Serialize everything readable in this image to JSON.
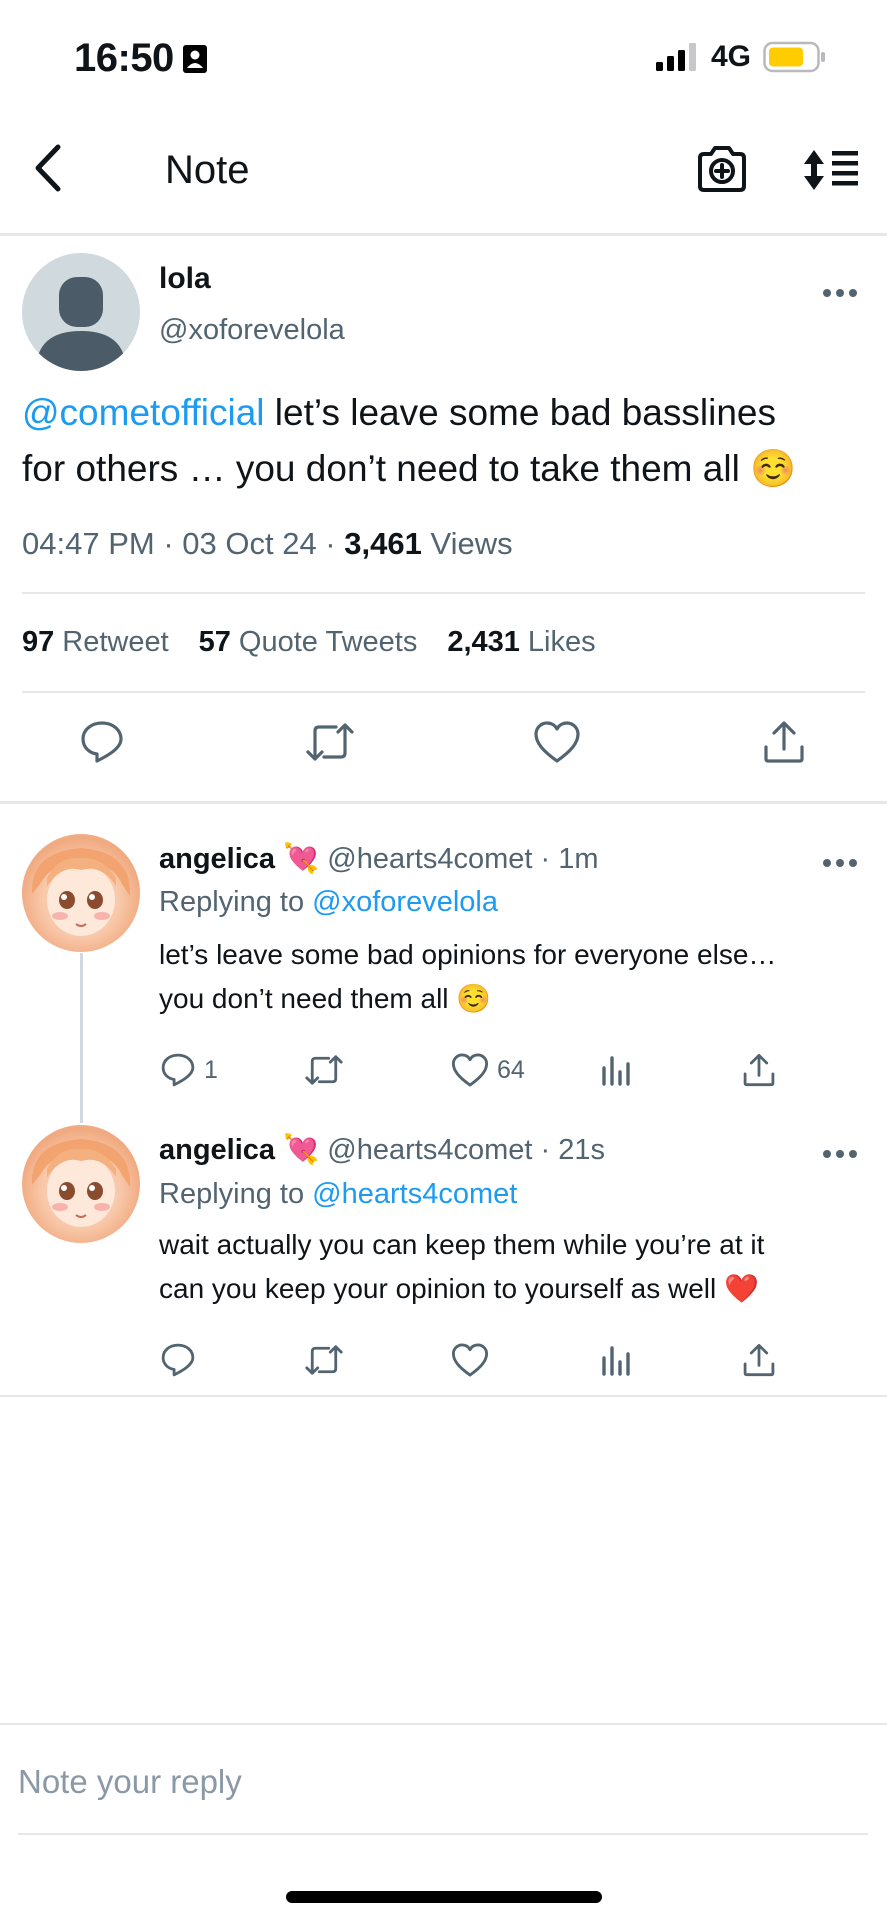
{
  "status_bar": {
    "time": "16:50",
    "network": "4G"
  },
  "header": {
    "title": "Note"
  },
  "tweet": {
    "name": "lola",
    "handle": "@xoforevelola",
    "mention": "@cometofficial",
    "text_line1": " let’s leave some bad basslines",
    "text_line2": "for others … you don’t need to take them all ☺️",
    "time": "04:47 PM",
    "date": "03 Oct 24",
    "views_count": "3,461",
    "views_label": "Views",
    "retweets_count": "97",
    "retweets_label": "Retweet",
    "quotes_count": "57",
    "quotes_label": "Quote Tweets",
    "likes_count": "2,431",
    "likes_label": "Likes"
  },
  "replies": [
    {
      "name": "angelica",
      "emoji": "💘",
      "handle": "@hearts4comet",
      "time": "1m",
      "replying_prefix": "Replying to ",
      "replying_to": "@xoforevelola",
      "text_line1": "let’s leave some bad opinions for everyone else…",
      "text_line2": "you don’t need them all ☺️",
      "reply_count": "1",
      "retweet_count": "",
      "like_count": "64"
    },
    {
      "name": "angelica",
      "emoji": "💘",
      "handle": "@hearts4comet",
      "time": "21s",
      "replying_prefix": "Replying to ",
      "replying_to": "@hearts4comet",
      "text_line1": "wait actually you can keep them while you’re at it",
      "text_line2": "can you keep your opinion to yourself as well ❤️",
      "reply_count": "",
      "retweet_count": "",
      "like_count": ""
    }
  ],
  "reply_box": {
    "placeholder": "Note your reply"
  },
  "colors": {
    "accent": "#1d9bf0",
    "secondary_text": "#536471",
    "divider": "#e5e7ea",
    "battery": "#ffcc00"
  }
}
